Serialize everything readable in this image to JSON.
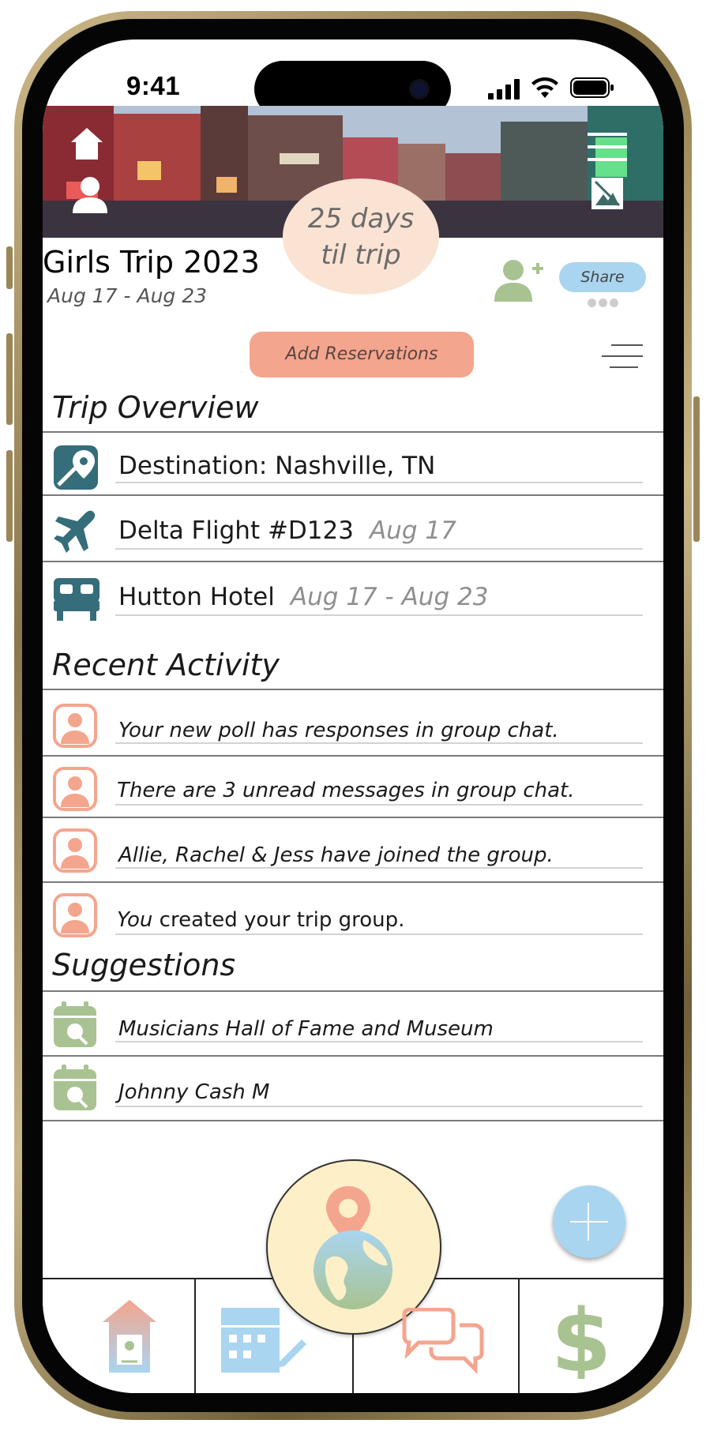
{
  "status_bar": {
    "time": "9:41"
  },
  "header": {
    "countdown_line1": "25 days",
    "countdown_line2": "til trip",
    "trip_title": "Girls Trip 2023",
    "trip_dates": "Aug 17 - Aug 23",
    "share_label": "Share",
    "add_reservations_label": "Add Reservations"
  },
  "overview": {
    "heading": "Trip Overview",
    "items": [
      {
        "icon": "map-pin-icon",
        "label": "Destination: Nashville, TN",
        "sub": ""
      },
      {
        "icon": "airplane-icon",
        "label": "Delta Flight #D123",
        "sub": "Aug 17"
      },
      {
        "icon": "bed-icon",
        "label": "Hutton Hotel",
        "sub": "Aug 17 - Aug 23"
      }
    ]
  },
  "activity": {
    "heading": "Recent Activity",
    "items": [
      {
        "icon": "user-avatar-icon",
        "text": "Your new poll has responses in group chat."
      },
      {
        "icon": "user-avatar-icon",
        "text": "There are 3 unread messages in group chat."
      },
      {
        "icon": "user-avatar-icon",
        "text": "Allie, Rachel & Jess have joined the group."
      },
      {
        "icon": "user-avatar-icon",
        "text_italic": "You",
        "text_rest": " created your trip group."
      }
    ]
  },
  "suggestions": {
    "heading": "Suggestions",
    "items": [
      {
        "icon": "calendar-search-icon",
        "text": "Musicians Hall of Fame and Museum"
      },
      {
        "icon": "calendar-search-icon",
        "text": "Johnny Cash M"
      }
    ]
  },
  "tabbar": {
    "tabs": [
      "home-icon",
      "calendar-edit-icon",
      "globe-pin-icon",
      "chat-icon",
      "dollar-icon"
    ]
  },
  "colors": {
    "teal": "#356d7a",
    "salmon": "#f4a58e",
    "sage": "#a8c391",
    "sky": "#a9d5f0",
    "cream": "#fdefc8",
    "peach": "#fbe3d3"
  }
}
